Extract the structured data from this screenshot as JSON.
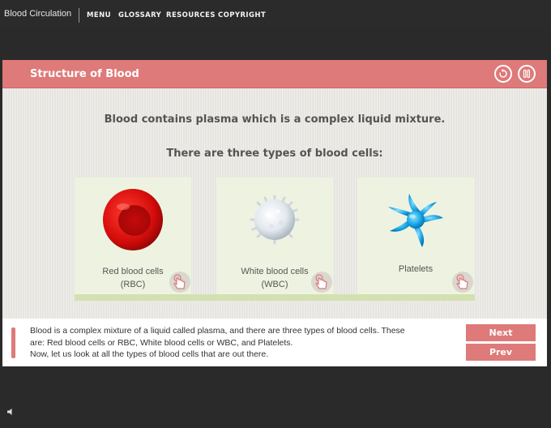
{
  "app": {
    "title": "Blood Circulation"
  },
  "nav": [
    {
      "label": "MENU"
    },
    {
      "label": "GLOSSARY"
    },
    {
      "label": "RESOURCES"
    },
    {
      "label": "COPYRIGHT"
    }
  ],
  "header": {
    "title": "Structure of Blood",
    "replay_icon": "replay-icon",
    "pause_icon": "pause-icon"
  },
  "content": {
    "line1": "Blood contains plasma which is a complex liquid mixture.",
    "line2": "There are three types of blood cells:",
    "cards": [
      {
        "label_line1": "Red blood cells",
        "label_line2": "(RBC)",
        "image": "red-blood-cell"
      },
      {
        "label_line1": "White blood cells",
        "label_line2": "(WBC)",
        "image": "white-blood-cell"
      },
      {
        "label_line1": "Platelets",
        "label_line2": "",
        "image": "platelet"
      }
    ],
    "hand_icon": "tap-hand-icon"
  },
  "footer": {
    "lines": [
      "Blood is a complex mixture of a liquid called plasma, and there are three types of blood cells. These",
      "are: Red blood cells or RBC, White blood cells or WBC, and Platelets.",
      "Now, let us look at all the types of blood cells that are out there."
    ],
    "next_label": "Next",
    "prev_label": "Prev"
  },
  "colors": {
    "accent": "#de7a79",
    "card": "#eef3e1",
    "strip": "#d3e1b1",
    "background": "#2a2a2a"
  }
}
